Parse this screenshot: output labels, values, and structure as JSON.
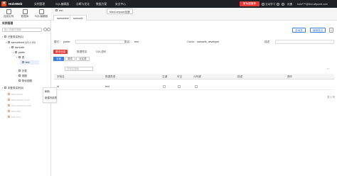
{
  "header": {
    "logo_letter": "H",
    "brand": "HoloWeb",
    "nav": [
      "实例管理",
      "SQL编辑器",
      "诊断与优化",
      "数据方案",
      "安全中心"
    ],
    "cta": "新功能推荐",
    "help": "互动学习",
    "user_email": "holo****@test.aliyunid.com",
    "settings": "设置"
  },
  "toolbar": {
    "items": [
      "连接实例",
      "数据库",
      "SQL编辑器"
    ]
  },
  "tabs": {
    "file_tab": "test",
    "tooltip": "MaxCompute加速",
    "open": [
      "samuetest",
      "samuelb"
    ]
  },
  "sidebar": {
    "title": "实例管理",
    "search_placeholder": "输入关键字搜索",
    "tree": [
      {
        "label": "已登录实例(1)",
        "depth": 0,
        "arrow": "▾",
        "dim": false
      },
      {
        "label": "samuelbest (V1.1.20)",
        "depth": 1,
        "arrow": "▾",
        "dim": false
      },
      {
        "label": "samuelb",
        "depth": 2,
        "arrow": "▾",
        "dim": false
      },
      {
        "label": "public",
        "depth": 3,
        "arrow": "▾",
        "dim": false
      },
      {
        "label": "表",
        "depth": 4,
        "arrow": "▾",
        "dim": false
      },
      {
        "label": "test",
        "depth": 5,
        "arrow": "",
        "dim": false,
        "selected": true
      },
      {
        "label": "外表",
        "depth": 4,
        "arrow": "›",
        "dim": false
      },
      {
        "label": "视图",
        "depth": 4,
        "arrow": "›",
        "dim": false
      },
      {
        "label": "物化视图",
        "depth": 4,
        "arrow": "›",
        "dim": false
      },
      {
        "label": "未登录实例(5)",
        "depth": 0,
        "arrow": "▾",
        "dim": false
      },
      {
        "label": "samuetest",
        "depth": 1,
        "arrow": "",
        "dim": true
      },
      {
        "label": "samuetest-hz-sh",
        "depth": 1,
        "arrow": "",
        "dim": true
      },
      {
        "label": "holo-instance-test",
        "depth": 1,
        "arrow": "",
        "dim": true
      },
      {
        "label": "samuelb",
        "depth": 1,
        "arrow": "",
        "dim": true
      },
      {
        "label": "test-holo",
        "depth": 1,
        "arrow": "",
        "dim": true
      }
    ],
    "context_menu": [
      "刷新",
      "新建内部表"
    ]
  },
  "main": {
    "sub_tabs": [
      "samuetest",
      "samuelb"
    ],
    "buttons": {
      "query": "查询表",
      "edit": "编辑表名",
      "close": "×"
    },
    "meta": {
      "mode_label": "模式：",
      "mode_value": "public",
      "table_label": "表名：",
      "table_value": "test",
      "owner_label": "Owner:",
      "owner_value": "samuelb_developer",
      "desc_label": "描述"
    },
    "detail_tabs": [
      "基本信息",
      "数据预览",
      "DDL语句"
    ],
    "col_tabs": [
      "字段",
      "属性",
      "分区表"
    ],
    "search_placeholder": "字段名搜索",
    "pager": "‹ ›",
    "columns": [
      "字段名",
      "数据类型",
      "主键",
      "可空",
      "分布键",
      "描述",
      "操作"
    ],
    "rows": [
      {
        "name": "id",
        "type": "text",
        "pk": false,
        "nullable": false,
        "dist": false,
        "desc": "",
        "op": ""
      }
    ],
    "footer": "共 1 行"
  },
  "colors": {
    "topbar": "#1f2126",
    "accent_red": "#e53935",
    "accent_blue": "#3b7ddd"
  }
}
